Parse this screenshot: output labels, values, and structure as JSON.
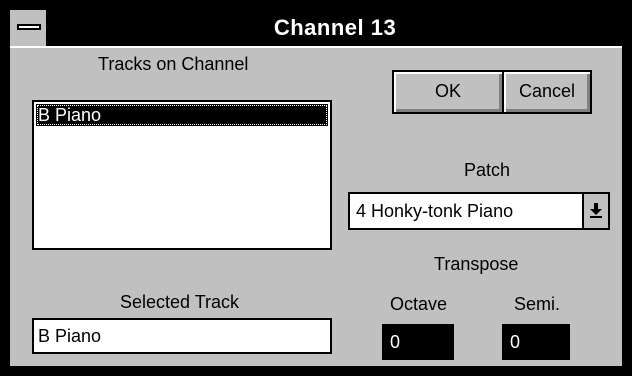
{
  "window": {
    "title": "Channel 13"
  },
  "icons": {
    "system_menu": "system-menu-icon",
    "dropdown": "down-arrow-icon"
  },
  "colors": {
    "title_bar": "#000000",
    "dialog": "#c0c0c0",
    "selection": "#000000"
  },
  "tracks": {
    "label": "Tracks on Channel",
    "items": [
      {
        "label": "B Piano",
        "selected": true
      }
    ]
  },
  "selected_track": {
    "label": "Selected Track",
    "value": "B Piano"
  },
  "buttons": {
    "ok": "OK",
    "cancel": "Cancel"
  },
  "patch": {
    "label": "Patch",
    "value": "4  Honky-tonk Piano"
  },
  "transpose": {
    "label": "Transpose",
    "octave_label": "Octave",
    "octave_value": "0",
    "semi_label": "Semi.",
    "semi_value": "0"
  }
}
